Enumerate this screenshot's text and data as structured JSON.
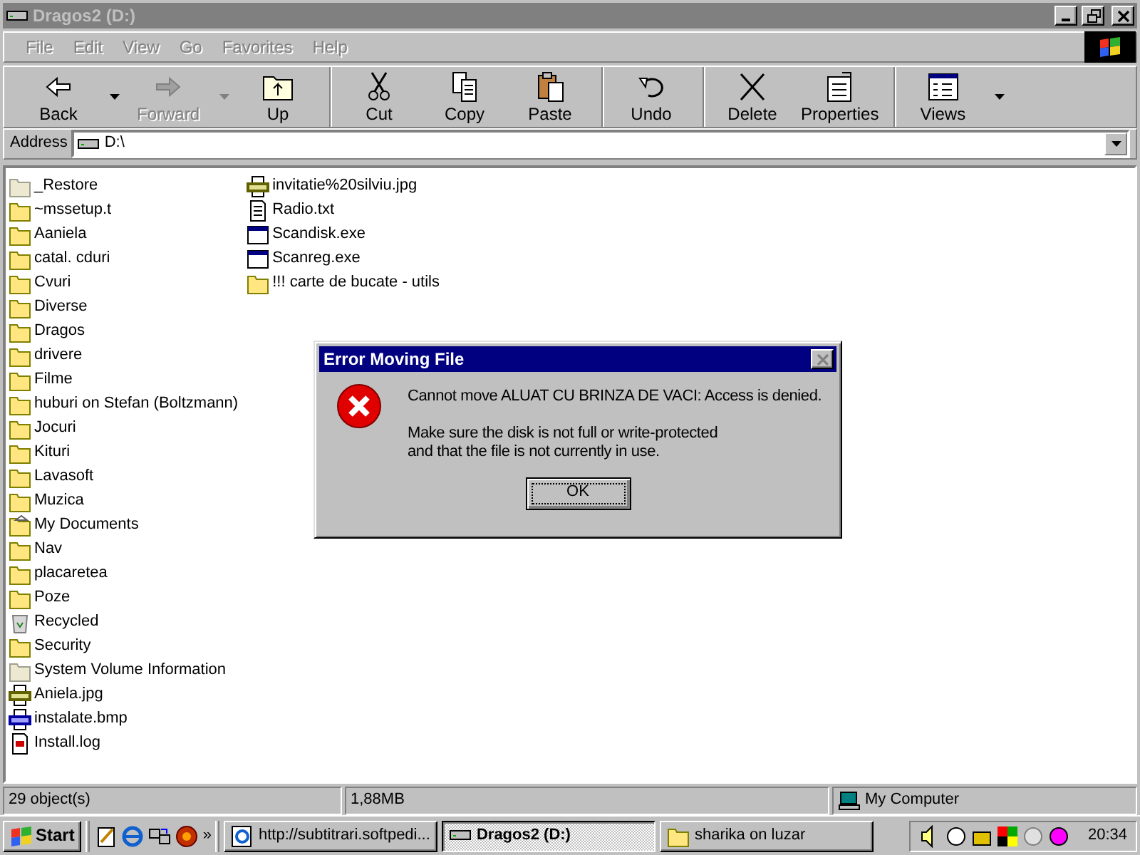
{
  "window": {
    "title": "Dragos2 (D:)",
    "active": false
  },
  "menu": [
    {
      "label": "File"
    },
    {
      "label": "Edit"
    },
    {
      "label": "View"
    },
    {
      "label": "Go"
    },
    {
      "label": "Favorites"
    },
    {
      "label": "Help"
    }
  ],
  "toolbar": [
    {
      "label": "Back",
      "kind": "back",
      "disabled": false,
      "dropdown": true,
      "separator_before": false
    },
    {
      "label": "Forward",
      "kind": "forward",
      "disabled": true,
      "dropdown": true,
      "separator_before": false
    },
    {
      "label": "Up",
      "kind": "up",
      "disabled": false,
      "dropdown": false,
      "separator_before": false
    },
    {
      "label": "Cut",
      "kind": "cut",
      "disabled": false,
      "dropdown": false,
      "separator_before": true
    },
    {
      "label": "Copy",
      "kind": "copy",
      "disabled": false,
      "dropdown": false,
      "separator_before": false
    },
    {
      "label": "Paste",
      "kind": "paste",
      "disabled": false,
      "dropdown": false,
      "separator_before": false
    },
    {
      "label": "Undo",
      "kind": "undo",
      "disabled": false,
      "dropdown": false,
      "separator_before": true
    },
    {
      "label": "Delete",
      "kind": "delete",
      "disabled": false,
      "dropdown": false,
      "separator_before": true
    },
    {
      "label": "Properties",
      "kind": "properties",
      "disabled": false,
      "dropdown": false,
      "separator_before": false
    },
    {
      "label": "Views",
      "kind": "views",
      "disabled": false,
      "dropdown": true,
      "separator_before": true
    }
  ],
  "address": {
    "label": "Address",
    "value": "D:\\"
  },
  "file_columns": [
    {
      "items": [
        {
          "name": "_Restore",
          "kind": "system-folder"
        },
        {
          "name": "~mssetup.t",
          "kind": "folder"
        },
        {
          "name": "Aaniela",
          "kind": "folder"
        },
        {
          "name": "catal. cduri",
          "kind": "folder"
        },
        {
          "name": "Cvuri",
          "kind": "folder"
        },
        {
          "name": "Diverse",
          "kind": "folder"
        },
        {
          "name": "Dragos",
          "kind": "folder"
        },
        {
          "name": "drivere",
          "kind": "folder"
        },
        {
          "name": "Filme",
          "kind": "folder"
        },
        {
          "name": "huburi on Stefan (Boltzmann)",
          "kind": "folder"
        },
        {
          "name": "Jocuri",
          "kind": "folder"
        },
        {
          "name": "Kituri",
          "kind": "folder"
        },
        {
          "name": "Lavasoft",
          "kind": "folder"
        },
        {
          "name": "Muzica",
          "kind": "folder"
        },
        {
          "name": "My Documents",
          "kind": "documents"
        },
        {
          "name": "Nav",
          "kind": "folder"
        },
        {
          "name": "placaretea",
          "kind": "folder"
        },
        {
          "name": "Poze",
          "kind": "folder"
        },
        {
          "name": "Recycled",
          "kind": "recycle"
        },
        {
          "name": "Security",
          "kind": "folder"
        },
        {
          "name": "System Volume Information",
          "kind": "system-folder"
        },
        {
          "name": "Aniela.jpg",
          "kind": "jpg"
        },
        {
          "name": "instalate.bmp",
          "kind": "bmp"
        },
        {
          "name": "Install.log",
          "kind": "log"
        }
      ]
    },
    {
      "items": [
        {
          "name": "invitatie%20silviu.jpg",
          "kind": "jpg"
        },
        {
          "name": "Radio.txt",
          "kind": "txt"
        },
        {
          "name": "Scandisk.exe",
          "kind": "exe"
        },
        {
          "name": "Scanreg.exe",
          "kind": "exe"
        },
        {
          "name": "!!! carte de bucate - utils",
          "kind": "folder"
        }
      ]
    }
  ],
  "dialog": {
    "title": "Error Moving File",
    "message": "Cannot move ALUAT CU BRINZA DE VACI: Access is denied.",
    "details": [
      "Make sure the disk is not full or write-protected",
      "and that the file is not currently in use."
    ],
    "button": "OK"
  },
  "status_bar": [
    {
      "text": "29 object(s)",
      "kind": "plain"
    },
    {
      "text": "1,88MB",
      "kind": "plain"
    },
    {
      "text": "My Computer",
      "kind": "computer"
    }
  ],
  "taskbar": {
    "start": "Start",
    "more": "»",
    "tasks": [
      {
        "label": "http://subtitrari.softpedi...",
        "kind": "browser",
        "selected": false
      },
      {
        "label": "Dragos2 (D:)",
        "kind": "drive",
        "selected": true
      },
      {
        "label": "sharika on luzar",
        "kind": "folder",
        "selected": false
      }
    ],
    "clock": "20:34"
  }
}
